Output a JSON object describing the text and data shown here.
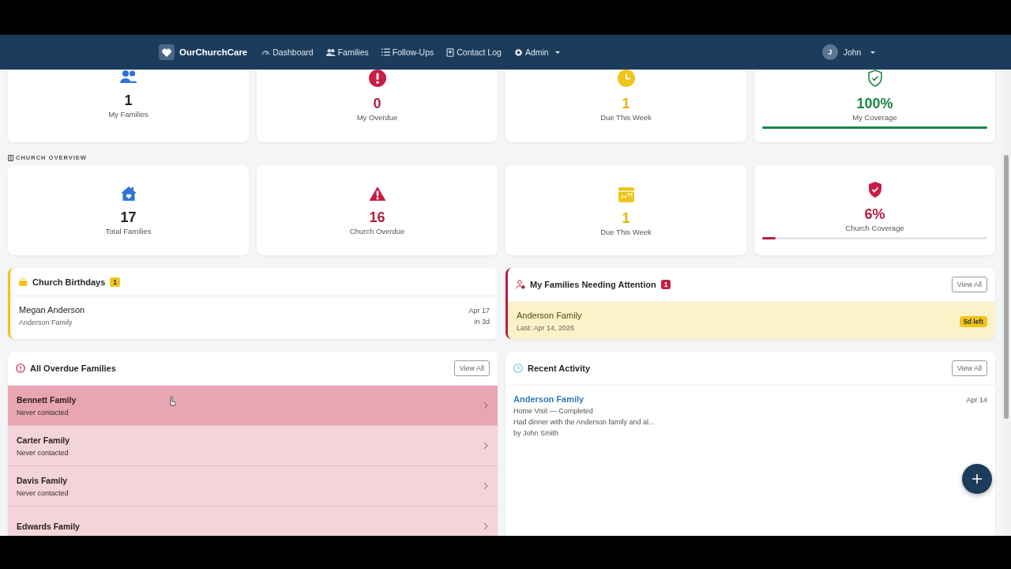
{
  "nav": {
    "brand": "OurChurchCare",
    "links": [
      {
        "label": "Dashboard"
      },
      {
        "label": "Families"
      },
      {
        "label": "Follow-Ups"
      },
      {
        "label": "Contact Log"
      }
    ],
    "admin": "Admin",
    "user": {
      "initial": "J",
      "name": "John"
    }
  },
  "my_stats": [
    {
      "value": "1",
      "label": "My Families",
      "color": "#1f2328"
    },
    {
      "value": "0",
      "label": "My Overdue",
      "color": "#b3203f"
    },
    {
      "value": "1",
      "label": "Due This Week",
      "color": "#e3b505"
    },
    {
      "value": "100%",
      "label": "My Coverage",
      "color": "#1e8449",
      "level": 1
    }
  ],
  "church_overview": {
    "heading": "CHURCH OVERVIEW",
    "stats": [
      {
        "value": "17",
        "label": "Total Families",
        "color": "#1f2328"
      },
      {
        "value": "16",
        "label": "Church Overdue",
        "color": "#b3203f"
      },
      {
        "value": "1",
        "label": "Due This Week",
        "color": "#e3b505"
      },
      {
        "value": "6%",
        "label": "Church Coverage",
        "color": "#b3203f",
        "level": 0.06
      }
    ]
  },
  "birthdays": {
    "title": "Church Birthdays",
    "count": "1",
    "items": [
      {
        "name": "Megan Anderson",
        "family": "Anderson Family",
        "date": "Apr 17",
        "relative": "in 3d"
      }
    ]
  },
  "attention": {
    "title": "My Families Needing Attention",
    "count": "1",
    "action": "View All",
    "items": [
      {
        "name": "Anderson Family",
        "last": "Last: Apr 14, 2026",
        "badge": "5d left"
      }
    ]
  },
  "overdue": {
    "title": "All Overdue Families",
    "action": "View All",
    "items": [
      {
        "name": "Bennett Family",
        "status": "Never contacted",
        "highlighted": true
      },
      {
        "name": "Carter Family",
        "status": "Never contacted",
        "highlighted": false
      },
      {
        "name": "Davis Family",
        "status": "Never contacted",
        "highlighted": false
      },
      {
        "name": "Edwards Family",
        "highlighted": false
      }
    ]
  },
  "recent": {
    "title": "Recent Activity",
    "action": "View All",
    "items": [
      {
        "family": "Anderson Family",
        "date": "Apr 14",
        "type": "Home Visit — Completed",
        "note": "Had dinner with the Anderson family and al...",
        "by": "by John Smith"
      }
    ]
  }
}
